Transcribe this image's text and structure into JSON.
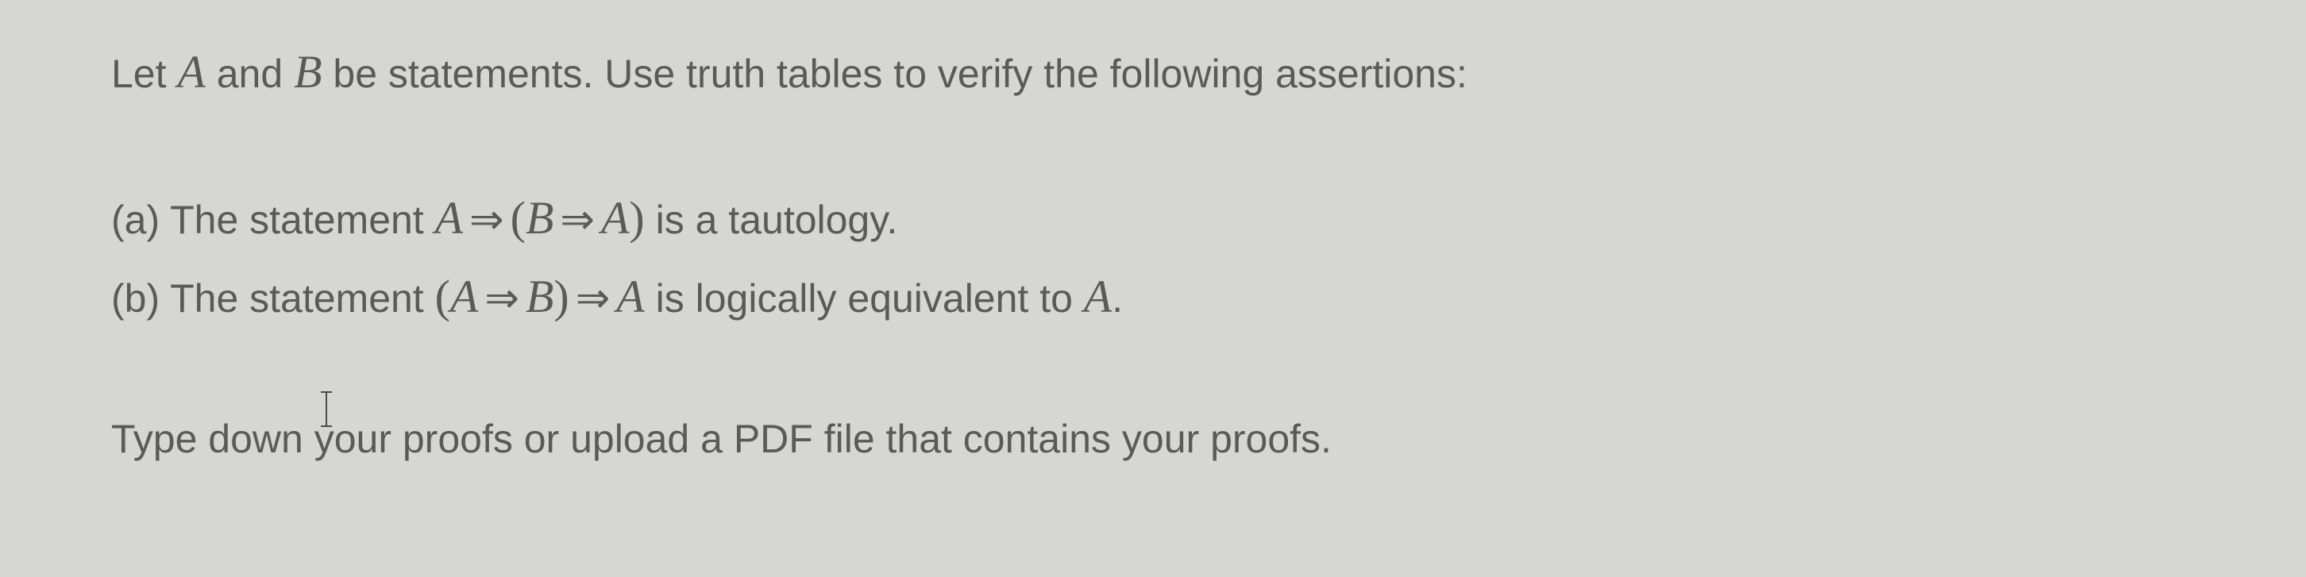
{
  "intro": {
    "prefix": "Let ",
    "varA": "A",
    "mid1": " and ",
    "varB": "B",
    "suffix": " be statements. Use truth tables to verify the following assertions:"
  },
  "partA": {
    "label": "(a) The statement ",
    "math_A": "A",
    "arrow1": "⇒",
    "lparen": "(",
    "math_B": "B",
    "arrow2": "⇒",
    "math_A2": "A",
    "rparen": ")",
    "suffix": " is a tautology."
  },
  "partB": {
    "label": "(b) The statement ",
    "lparen": "(",
    "math_A": "A",
    "arrow1": "⇒",
    "math_B": "B",
    "rparen": ")",
    "arrow2": "⇒",
    "math_A2": "A",
    "mid": " is logically equivalent to ",
    "math_A3": "A",
    "suffix": "."
  },
  "instructions": "Type down your proofs or upload a PDF file that contains your proofs."
}
